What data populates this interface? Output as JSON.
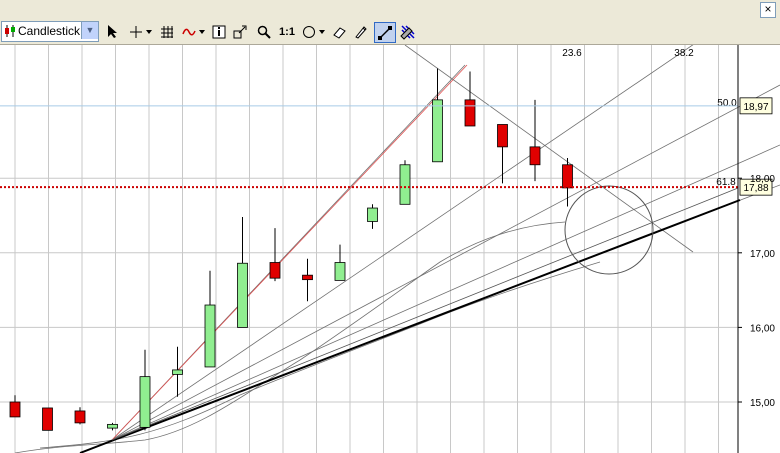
{
  "toolbar": {
    "chart_type": "Candlestick",
    "buttons": [
      "pointer",
      "crosshair",
      "grid",
      "indicator",
      "info",
      "zoom-area",
      "zoom",
      "one-to-one",
      "ellipse",
      "eraser",
      "draw",
      "fibonacci-fan",
      "settings"
    ],
    "one_to_one_label": "1:1"
  },
  "window": {
    "close_label": "×"
  },
  "chart_data": {
    "type": "candlestick",
    "ylim": [
      14.4,
      18.8
    ],
    "y_ticks": [
      {
        "value": 15.0,
        "label": "15,00"
      },
      {
        "value": 16.0,
        "label": "16,00"
      },
      {
        "value": 17.0,
        "label": "17,00"
      },
      {
        "value": 18.0,
        "label": "18,00"
      }
    ],
    "price_markers": [
      {
        "value": 18.97,
        "label": "18,97",
        "line_color": "#a8cbe6",
        "style": "solid"
      },
      {
        "value": 17.88,
        "label": "17,88",
        "line_color": "#cc0000",
        "style": "dotted"
      }
    ],
    "fib_labels": [
      {
        "label": "23.6"
      },
      {
        "label": "38.2"
      },
      {
        "label": "50.0"
      },
      {
        "label": "61.8"
      }
    ],
    "candles": [
      {
        "o": 15.0,
        "h": 15.09,
        "l": 14.8,
        "c": 14.8
      },
      {
        "o": 14.92,
        "h": 14.92,
        "l": 14.62,
        "c": 14.62
      },
      {
        "o": 14.88,
        "h": 14.93,
        "l": 14.7,
        "c": 14.72
      },
      {
        "o": 14.65,
        "h": 14.72,
        "l": 14.62,
        "c": 14.7
      },
      {
        "o": 14.66,
        "h": 15.7,
        "l": 14.62,
        "c": 15.34
      },
      {
        "o": 15.37,
        "h": 15.74,
        "l": 15.07,
        "c": 15.43
      },
      {
        "o": 15.47,
        "h": 16.76,
        "l": 15.47,
        "c": 16.3
      },
      {
        "o": 16.0,
        "h": 17.48,
        "l": 16.0,
        "c": 16.86
      },
      {
        "o": 16.87,
        "h": 17.33,
        "l": 16.62,
        "c": 16.66
      },
      {
        "o": 16.7,
        "h": 16.92,
        "l": 16.35,
        "c": 16.64
      },
      {
        "o": 16.63,
        "h": 17.11,
        "l": 16.63,
        "c": 16.87
      },
      {
        "o": 17.42,
        "h": 17.65,
        "l": 17.32,
        "c": 17.6
      },
      {
        "o": 17.65,
        "h": 18.24,
        "l": 17.65,
        "c": 18.18
      },
      {
        "o": 18.22,
        "h": 19.47,
        "l": 18.22,
        "c": 19.05
      },
      {
        "o": 19.05,
        "h": 19.43,
        "l": 18.72,
        "c": 18.7
      },
      {
        "o": 18.72,
        "h": 18.72,
        "l": 17.93,
        "c": 18.42
      },
      {
        "o": 18.42,
        "h": 19.05,
        "l": 17.96,
        "c": 18.18
      },
      {
        "o": 18.18,
        "h": 18.27,
        "l": 17.62,
        "c": 17.87
      }
    ]
  }
}
